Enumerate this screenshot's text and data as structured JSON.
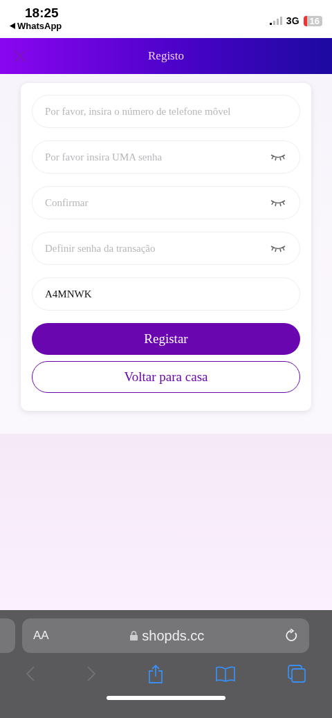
{
  "status_bar": {
    "time": "18:25",
    "back_app": "WhatsApp",
    "network": "3G",
    "battery": "16"
  },
  "header": {
    "title": "Registo"
  },
  "fields": [
    {
      "kind": "text",
      "placeholder": "Por favor, insira o número de telefone môvel"
    },
    {
      "kind": "password",
      "placeholder": "Por favor insira UMA senha"
    },
    {
      "kind": "password",
      "placeholder": "Confirmar"
    },
    {
      "kind": "password",
      "placeholder": "Definir senha da transação"
    },
    {
      "kind": "text",
      "value": "A4MNWK"
    }
  ],
  "buttons": [
    {
      "kind": "primary",
      "label": "Registar"
    },
    {
      "kind": "outline",
      "label": "Voltar para casa"
    }
  ],
  "browser": {
    "text_size": "AA",
    "url": "shopds.cc"
  }
}
